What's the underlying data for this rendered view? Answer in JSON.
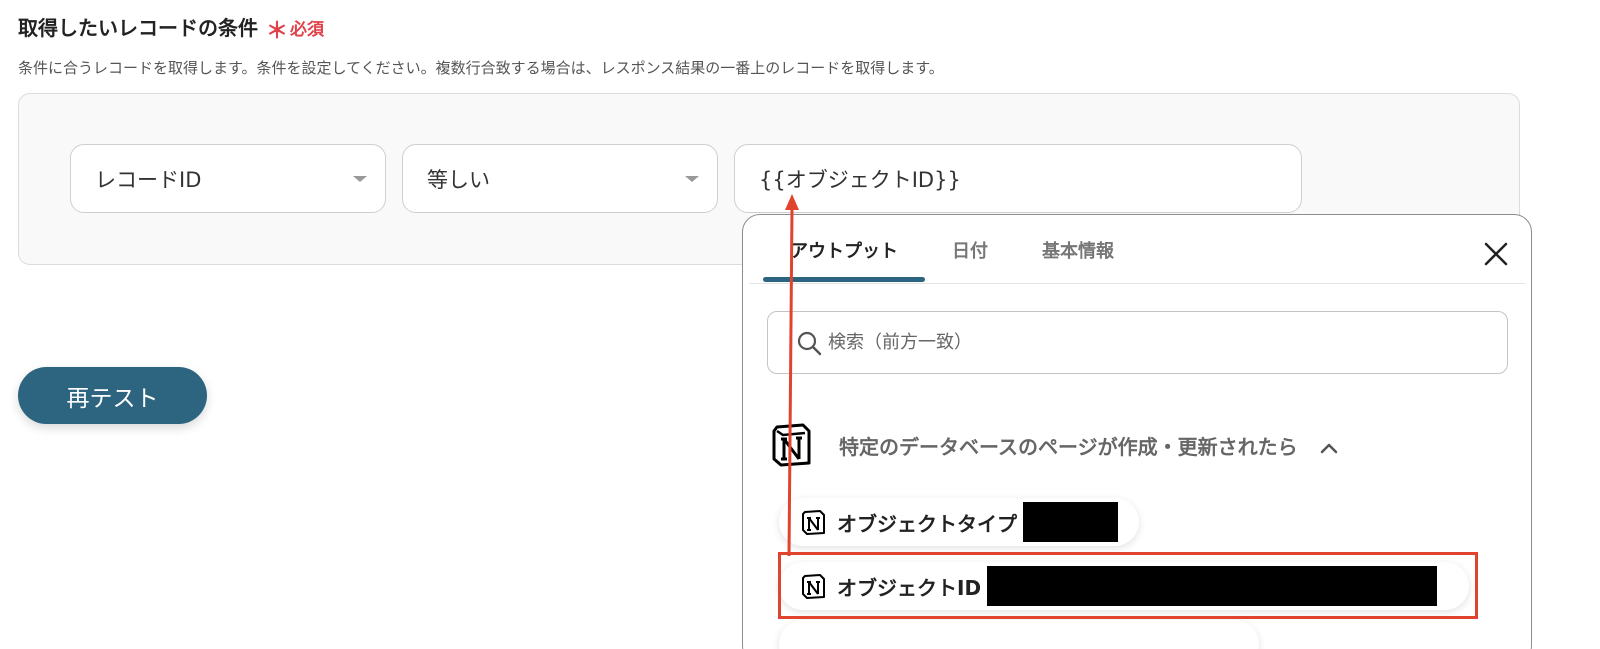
{
  "section": {
    "title": "取得したいレコードの条件",
    "required_mark": "＊",
    "required_label": "必須",
    "description": "条件に合うレコードを取得します。条件を設定してください。複数行合致する場合は、レスポンス結果の一番上のレコードを取得します。"
  },
  "condition": {
    "field_value": "レコードID",
    "operator_value": "等しい",
    "input_value": "{{オブジェクトID}}"
  },
  "retest_button": "再テスト",
  "panel": {
    "tabs": [
      {
        "label": "アウトプット",
        "active": true
      },
      {
        "label": "日付",
        "active": false
      },
      {
        "label": "基本情報",
        "active": false
      }
    ],
    "search_placeholder": "検索（前方一致）",
    "group_title": "特定のデータベースのページが作成・更新されたら",
    "items": [
      {
        "label": "オブジェクトタイプ",
        "value_redacted": true
      },
      {
        "label": "オブジェクトID",
        "value_redacted": true,
        "highlighted": true
      }
    ]
  },
  "colors": {
    "accent": "#2d6480",
    "required": "#e0424a",
    "annotation": "#e0442f"
  },
  "icons": [
    "search-icon",
    "close-icon",
    "notion-icon",
    "chevron-up-icon",
    "caret-down-icon"
  ]
}
